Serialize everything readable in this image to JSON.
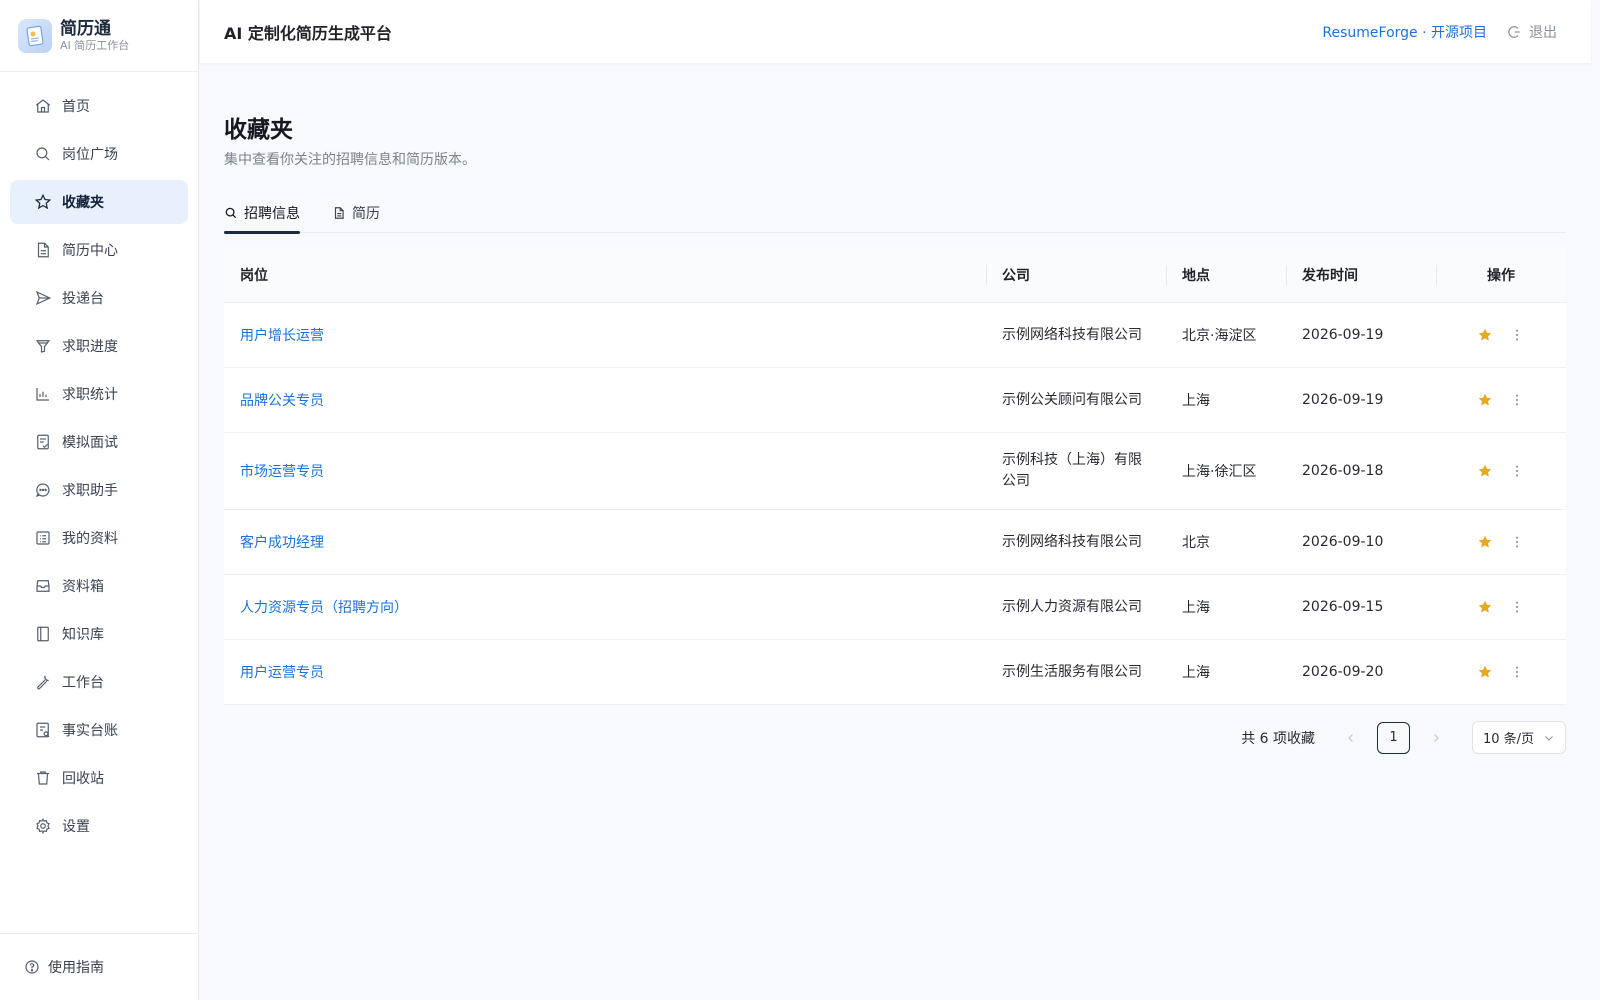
{
  "brand": {
    "name": "简历通",
    "subtitle": "AI 简历工作台"
  },
  "sidebar": {
    "items": [
      {
        "label": "首页",
        "icon": "home-icon"
      },
      {
        "label": "岗位广场",
        "icon": "search-icon"
      },
      {
        "label": "收藏夹",
        "icon": "star-icon",
        "active": true
      },
      {
        "label": "简历中心",
        "icon": "document-icon"
      },
      {
        "label": "投递台",
        "icon": "send-icon"
      },
      {
        "label": "求职进度",
        "icon": "funnel-icon"
      },
      {
        "label": "求职统计",
        "icon": "bar-chart-icon"
      },
      {
        "label": "模拟面试",
        "icon": "checklist-icon"
      },
      {
        "label": "求职助手",
        "icon": "chat-icon"
      },
      {
        "label": "我的资料",
        "icon": "profile-list-icon"
      },
      {
        "label": "资料箱",
        "icon": "inbox-icon"
      },
      {
        "label": "知识库",
        "icon": "book-icon"
      },
      {
        "label": "工作台",
        "icon": "wrench-icon"
      },
      {
        "label": "事实台账",
        "icon": "ledger-icon"
      },
      {
        "label": "回收站",
        "icon": "trash-icon"
      },
      {
        "label": "设置",
        "icon": "gear-icon"
      }
    ],
    "footer": {
      "label": "使用指南",
      "icon": "help-circle-icon"
    }
  },
  "header": {
    "title": "AI 定制化简历生成平台",
    "link": "ResumeForge · 开源项目",
    "logout": "退出"
  },
  "page": {
    "title": "收藏夹",
    "description": "集中查看你关注的招聘信息和简历版本。"
  },
  "tabs": [
    {
      "label": "招聘信息",
      "icon": "search-icon",
      "active": true
    },
    {
      "label": "简历",
      "icon": "document-icon"
    }
  ],
  "table": {
    "headers": [
      "岗位",
      "公司",
      "地点",
      "发布时间",
      "操作"
    ],
    "rows": [
      {
        "job": "用户增长运营",
        "company": "示例网络科技有限公司",
        "location": "北京·海淀区",
        "date": "2026-09-19"
      },
      {
        "job": "品牌公关专员",
        "company": "示例公关顾问有限公司",
        "location": "上海",
        "date": "2026-09-19"
      },
      {
        "job": "市场运营专员",
        "company": "示例科技（上海）有限公司",
        "location": "上海·徐汇区",
        "date": "2026-09-18"
      },
      {
        "job": "客户成功经理",
        "company": "示例网络科技有限公司",
        "location": "北京",
        "date": "2026-09-10"
      },
      {
        "job": "人力资源专员（招聘方向）",
        "company": "示例人力资源有限公司",
        "location": "上海",
        "date": "2026-09-15"
      },
      {
        "job": "用户运营专员",
        "company": "示例生活服务有限公司",
        "location": "上海",
        "date": "2026-09-20"
      }
    ]
  },
  "pagination": {
    "total": "共 6 项收藏",
    "current": "1",
    "page_size": "10 条/页"
  },
  "colors": {
    "accent": "#1a73d9",
    "active_bg": "#e8f0fb",
    "star": "#e5a823",
    "dark": "#1b2a3d"
  }
}
